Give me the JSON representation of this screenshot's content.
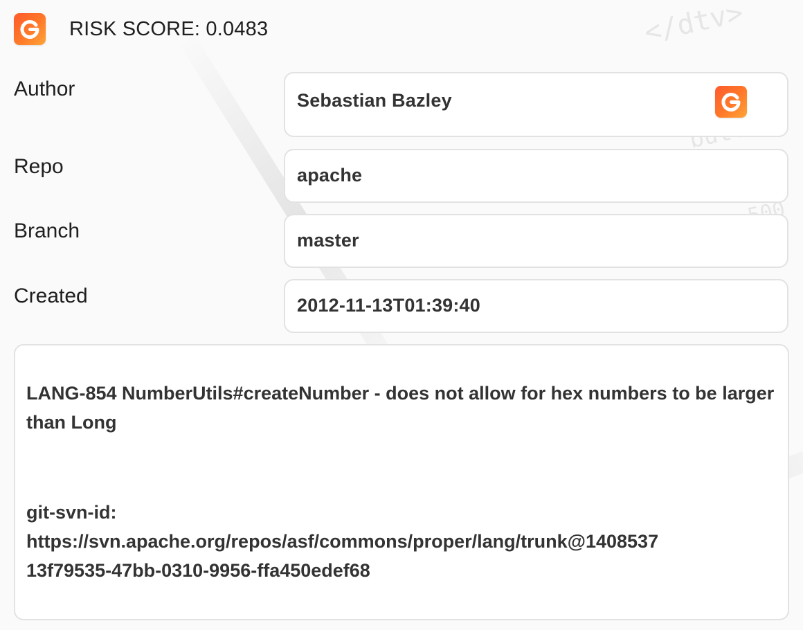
{
  "header": {
    "logo_icon": "g-logo-icon",
    "title": "RISK SCORE: 0.0483"
  },
  "brand": {
    "gradient_start": "#ff5a2c",
    "gradient_end": "#ffa537"
  },
  "fields": {
    "author": {
      "label": "Author",
      "value": "Sebastian Bazley",
      "badge_icon": "g-logo-icon"
    },
    "repo": {
      "label": "Repo",
      "value": "apache"
    },
    "branch": {
      "label": "Branch",
      "value": "master"
    },
    "created": {
      "label": "Created",
      "value": "2012-11-13T01:39:40"
    }
  },
  "message": {
    "lines": [
      "LANG-854 NumberUtils#createNumber - does not allow for hex numbers to be larger than Long",
      "git-svn-id:",
      "https://svn.apache.org/repos/asf/commons/proper/lang/trunk@1408537",
      "13f79535-47bb-0310-9956-ffa450edef68"
    ]
  }
}
